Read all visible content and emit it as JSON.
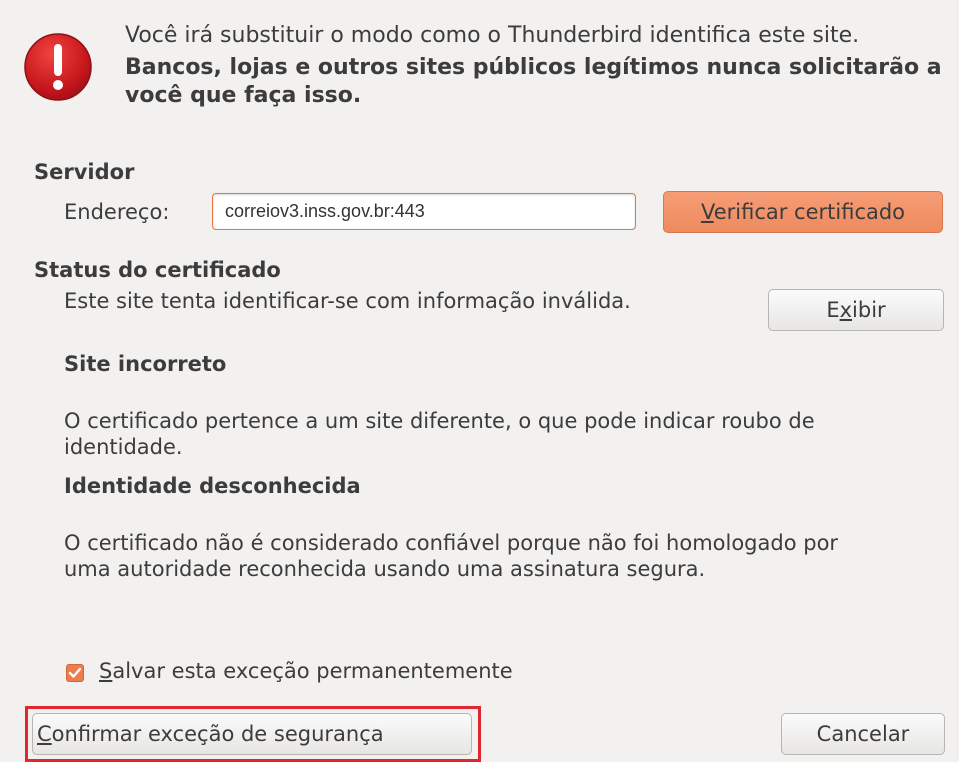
{
  "header": {
    "line1": "Você irá substituir o modo como o Thunderbird identifica este site.",
    "line2": "Bancos, lojas e outros sites públicos legítimos nunca solicitarão a você que faça isso."
  },
  "server": {
    "title": "Servidor",
    "address_label": "Endereço:",
    "address_value": "correiov3.inss.gov.br:443",
    "verify_button": {
      "mnemonic": "V",
      "rest": "erificar certificado"
    }
  },
  "status": {
    "title": "Status do certificado",
    "description": "Este site tenta identificar-se com informação inválida.",
    "view_button": {
      "before": "E",
      "mnemonic": "x",
      "after": "ibir"
    },
    "problems": [
      {
        "title": "Site incorreto",
        "text": "O certificado pertence a um site diferente, o que pode indicar roubo de identidade."
      },
      {
        "title": "Identidade desconhecida",
        "text": "O certificado não é considerado confiável porque não foi homologado por uma autoridade reconhecida usando uma assinatura segura."
      }
    ]
  },
  "save_permanently": {
    "checked": true,
    "mnemonic": "S",
    "rest": "alvar esta exceção permanentemente"
  },
  "buttons": {
    "confirm": {
      "mnemonic": "C",
      "rest": "onfirmar exceção de segurança"
    },
    "cancel": "Cancelar"
  },
  "colors": {
    "accent": "#ef7d4c",
    "highlight": "#e0262e",
    "warning_icon": "#c7171d"
  }
}
